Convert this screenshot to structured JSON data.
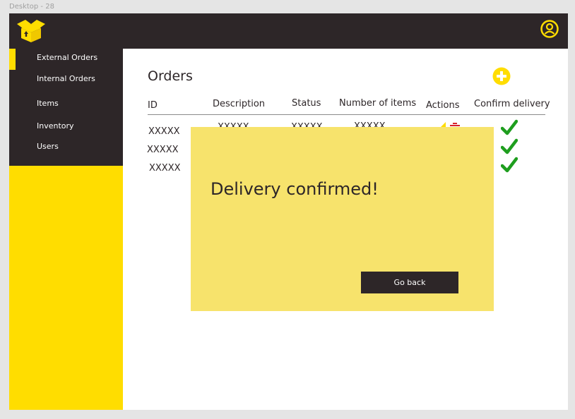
{
  "frame": {
    "label": "Desktop - 28"
  },
  "colors": {
    "dark": "#2d2628",
    "yellow": "#ffdd00",
    "modal": "#f7e36c",
    "check": "#1e9e1e",
    "delete": "#d8232a"
  },
  "header": {
    "logo_icon": "open-box-icon",
    "account_icon": "user-circle-icon"
  },
  "sidebar": {
    "items": [
      {
        "label": "External Orders",
        "active": true
      },
      {
        "label": "Internal Orders",
        "active": false
      },
      {
        "label": "Items",
        "active": false
      },
      {
        "label": "Inventory",
        "active": false
      },
      {
        "label": "Users",
        "active": false
      }
    ]
  },
  "main": {
    "title": "Orders",
    "add_icon": "plus-circle-icon",
    "table": {
      "columns": [
        "ID",
        "Description",
        "Status",
        "Number of items",
        "Actions",
        "Confirm delivery"
      ],
      "rows": [
        {
          "id": "XXXXX",
          "description": "XXXXX",
          "status": "XXXXX",
          "items": "XXXXX"
        },
        {
          "id": "XXXXX"
        },
        {
          "id": "XXXXX"
        }
      ]
    }
  },
  "modal": {
    "message": "Delivery confirmed!",
    "button_label": "Go back"
  }
}
